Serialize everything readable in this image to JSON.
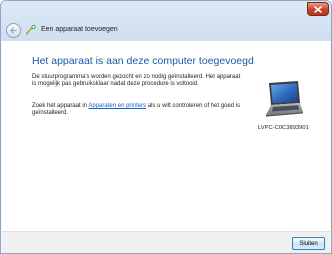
{
  "window": {
    "title": "Een apparaat toevoegen"
  },
  "main": {
    "heading": "Het apparaat is aan deze computer toegevoegd",
    "paragraph1": "De stuurprogramma's worden gezocht en zo nodig geïnstalleerd. Het apparaat is mogelijk pas gebruiksklaar nadat deze procedure is voltooid.",
    "paragraph2_prefix": "Zoek het apparaat in ",
    "paragraph2_link": "Apparaten en printers",
    "paragraph2_suffix": " als u wilt controleren of het goed is geïnstalleerd."
  },
  "device": {
    "name": "LVPC-C0C3893901",
    "icon": "laptop-icon"
  },
  "footer": {
    "close_label": "Sluiten"
  },
  "colors": {
    "heading": "#1d5aa6",
    "link": "#1a5fc3",
    "close_button": "#c7432b"
  }
}
